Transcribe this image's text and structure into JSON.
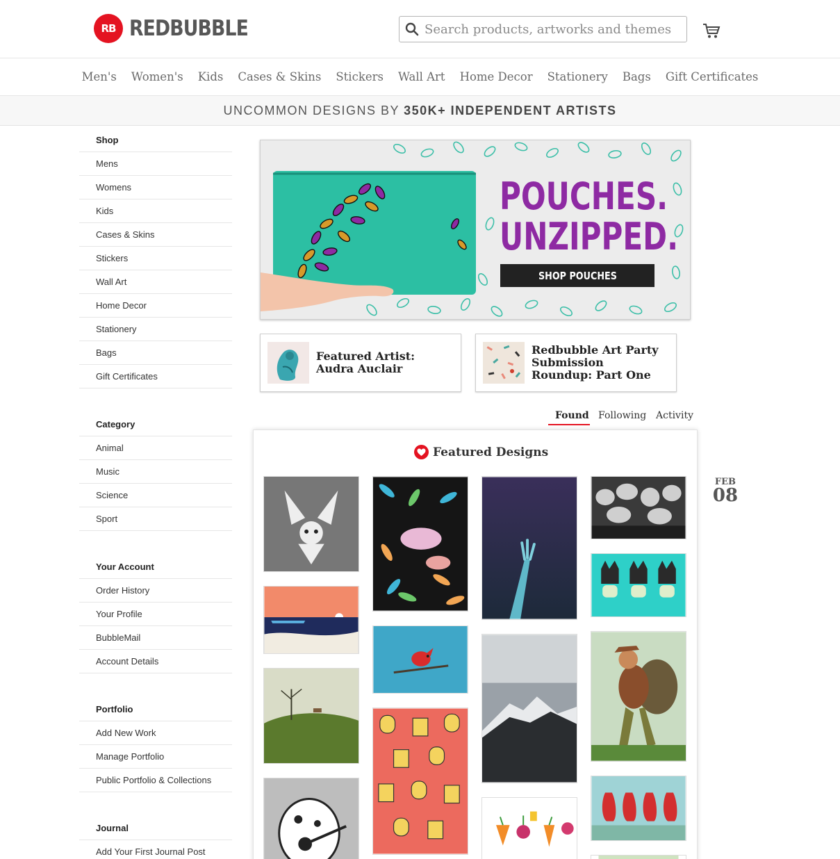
{
  "brand": {
    "logo_mark": "RB",
    "name": "REDBUBBLE"
  },
  "search": {
    "placeholder": "Search products, artworks and themes"
  },
  "icons": {
    "search": "search-icon",
    "cart": "cart-icon",
    "heart": "heart-icon"
  },
  "colors": {
    "accent": "#e41321",
    "hero_title": "#8e2aa3",
    "hero_bg": "#ececec"
  },
  "main_nav": [
    "Men's",
    "Women's",
    "Kids",
    "Cases & Skins",
    "Stickers",
    "Wall Art",
    "Home Decor",
    "Stationery",
    "Bags",
    "Gift Certificates"
  ],
  "tagline": {
    "prefix": "UNCOMMON DESIGNS BY",
    "bold": "350K+ INDEPENDENT ARTISTS"
  },
  "sidebar": {
    "shop": {
      "heading": "Shop",
      "items": [
        "Mens",
        "Womens",
        "Kids",
        "Cases & Skins",
        "Stickers",
        "Wall Art",
        "Home Decor",
        "Stationery",
        "Bags",
        "Gift Certificates"
      ]
    },
    "category": {
      "heading": "Category",
      "items": [
        "Animal",
        "Music",
        "Science",
        "Sport"
      ]
    },
    "account": {
      "heading": "Your Account",
      "items": [
        "Order History",
        "Your Profile",
        "BubbleMail",
        "Account Details"
      ]
    },
    "portfolio": {
      "heading": "Portfolio",
      "items": [
        "Add New Work",
        "Manage Portfolio",
        "Public Portfolio & Collections"
      ]
    },
    "journal": {
      "heading": "Journal",
      "items": [
        "Add Your First Journal Post"
      ]
    }
  },
  "hero": {
    "title_line1": "POUCHES.",
    "title_line2": "UNZIPPED.",
    "button": "SHOP POUCHES"
  },
  "cards": [
    {
      "title": "Featured Artist: Audra Auclair"
    },
    {
      "title": "Redbubble Art Party Submission Roundup: Part One"
    }
  ],
  "tabs": [
    "Found",
    "Following",
    "Activity"
  ],
  "active_tab": "Found",
  "feed": {
    "title": "Featured Designs"
  },
  "date": {
    "month": "FEB",
    "day": "08"
  }
}
